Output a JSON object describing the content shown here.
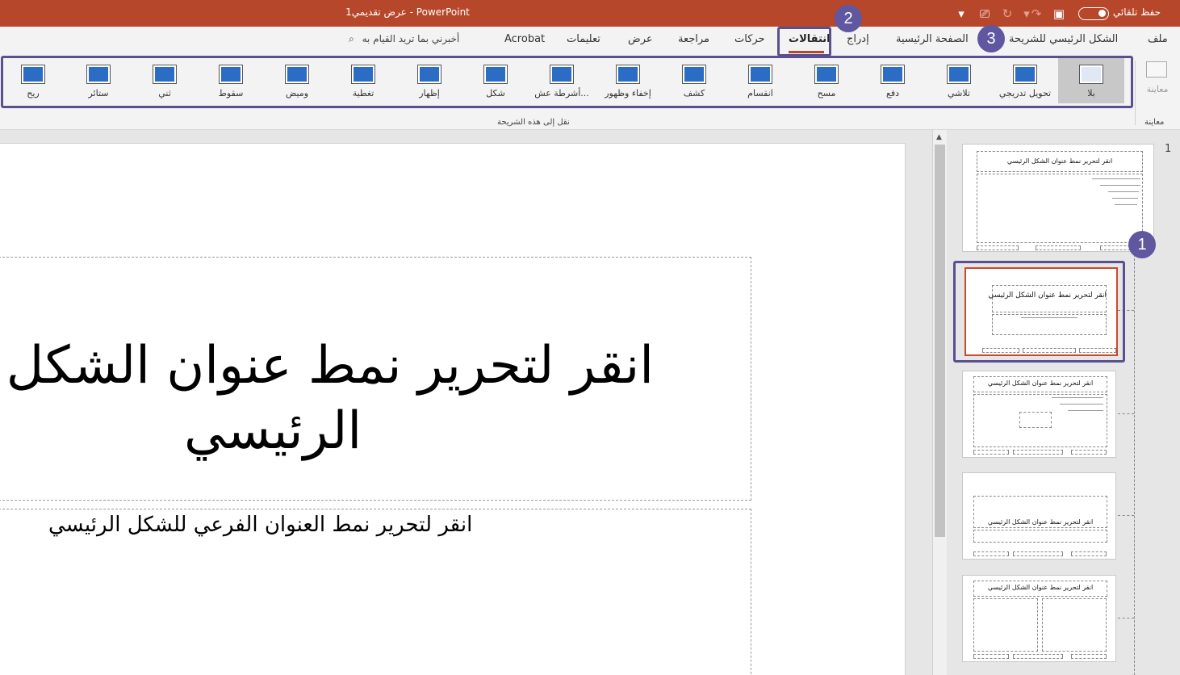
{
  "titlebar": {
    "title": "عرض تقديمي1  -  PowerPoint",
    "autosave_label": "حفظ تلقائي"
  },
  "tabs": [
    {
      "label": "ملف"
    },
    {
      "label": "الشكل الرئيسي للشريحة"
    },
    {
      "label": "الصفحة الرئيسية"
    },
    {
      "label": "إدراج"
    },
    {
      "label": "انتقالات"
    },
    {
      "label": "حركات"
    },
    {
      "label": "مراجعة"
    },
    {
      "label": "عرض"
    },
    {
      "label": "تعليمات"
    },
    {
      "label": "Acrobat"
    }
  ],
  "search": {
    "placeholder": "أخبرني بما تريد القيام به"
  },
  "ribbon": {
    "preview_label": "معاينة",
    "preview_group_label": "معاينة",
    "transitions_group_label": "نقل إلى هذه الشريحة",
    "transitions": [
      {
        "label": "بلا"
      },
      {
        "label": "تحويل تدريجي"
      },
      {
        "label": "تلاشي"
      },
      {
        "label": "دفع"
      },
      {
        "label": "مسح"
      },
      {
        "label": "انقسام"
      },
      {
        "label": "كشف"
      },
      {
        "label": "إخفاء وظهور"
      },
      {
        "label": "أشرطة عش..."
      },
      {
        "label": "شكل"
      },
      {
        "label": "إظهار"
      },
      {
        "label": "تغطية"
      },
      {
        "label": "وميض"
      },
      {
        "label": "سقوط"
      },
      {
        "label": "ثني"
      },
      {
        "label": "ستائر"
      },
      {
        "label": "ريح"
      }
    ]
  },
  "badges": {
    "one": "1",
    "two": "2",
    "three": "3"
  },
  "slide": {
    "title_line1": "انقر لتحرير نمط عنوان الشكل",
    "title_line2": "الرئيسي",
    "subtitle": "انقر لتحرير نمط العنوان الفرعي للشكل الرئيسي"
  },
  "thumbnails": {
    "slide_number": "1",
    "master_title": "انقر لتحرير نمط عنوان الشكل الرئيسي",
    "layout_title": "انقر لتحرير نمط عنوان الشكل الرئيسي",
    "section_title": "انقر لتحرير نمط عنوان الشكل الرئيسي"
  },
  "colors": {
    "accent": "#b7472a",
    "highlight": "#5a4f8f",
    "badge": "#5f57a0"
  }
}
